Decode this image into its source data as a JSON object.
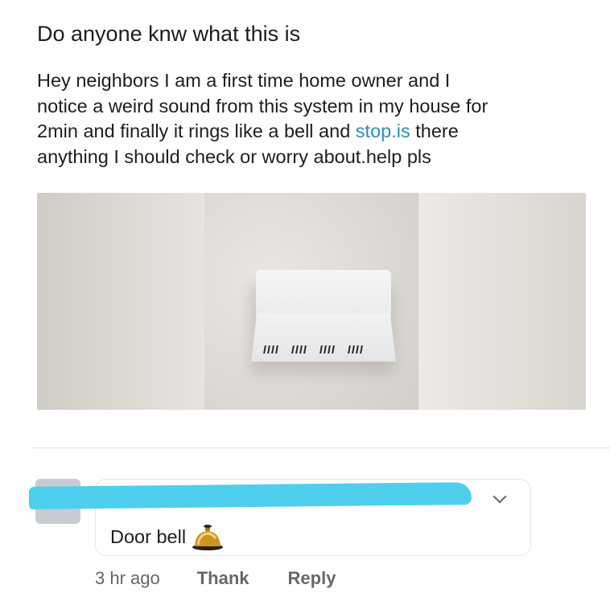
{
  "post": {
    "title": "Do anyone knw what this is",
    "body_lines": [
      "Hey neighbors I am a first time home owner and I",
      "notice a weird sound from this system in my house for",
      "2min and finally it rings  like a bell and ",
      "anything I should check or worry about.help pls"
    ],
    "link_text": "stop.is",
    "after_link": " there"
  },
  "photo": {
    "icon": "doorbell-chime-photo"
  },
  "comment": {
    "text": "Door bell",
    "icon": "bell-icon",
    "menu_icon": "chevron-down-icon",
    "redaction_color": "#4ecfee"
  },
  "actions": {
    "time": "3 hr ago",
    "thank": "Thank",
    "reply": "Reply"
  },
  "colors": {
    "link": "#2d8fb8",
    "secondary_text": "#65676b"
  }
}
